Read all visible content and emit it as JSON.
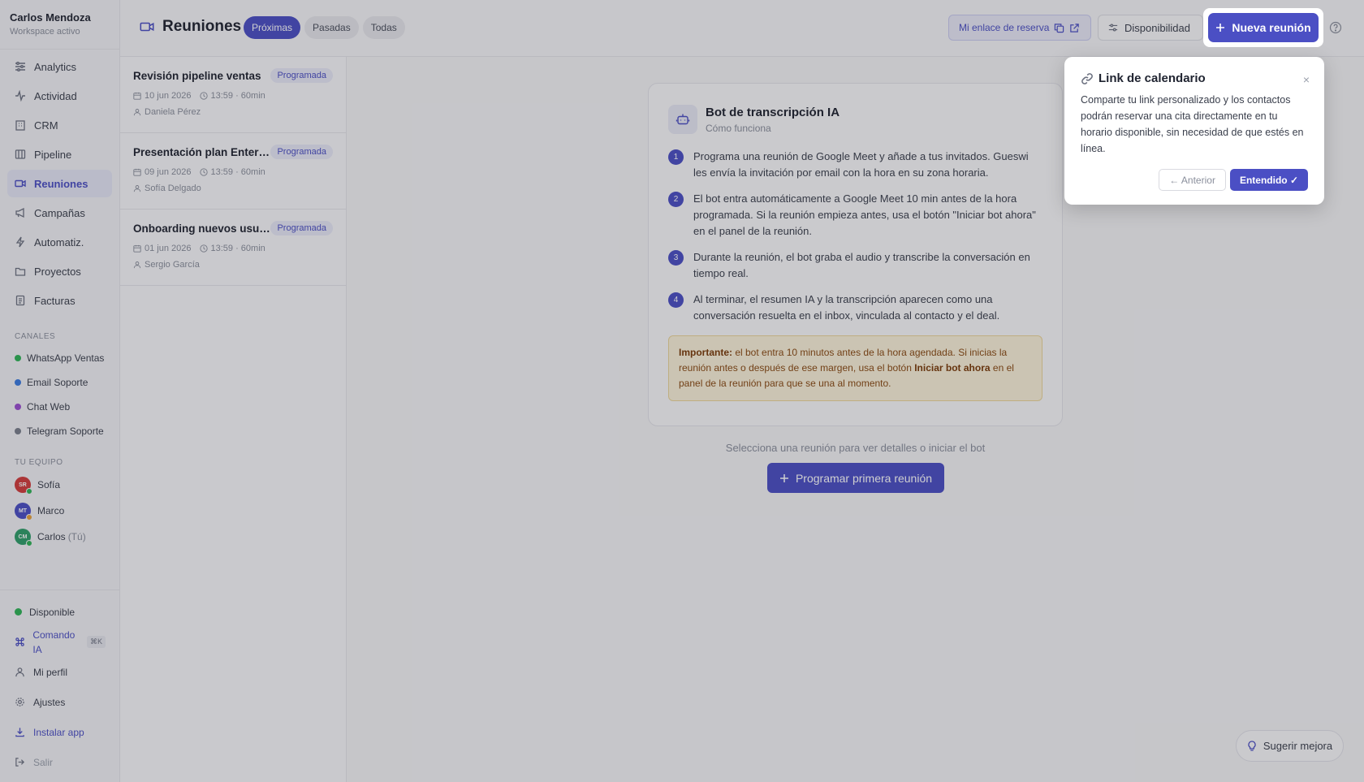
{
  "user": {
    "name": "Carlos Mendoza",
    "subtitle": "Workspace activo"
  },
  "nav": [
    {
      "label": "Analytics",
      "icon": "sliders-icon"
    },
    {
      "label": "Actividad",
      "icon": "activity-icon"
    },
    {
      "label": "CRM",
      "icon": "building-icon"
    },
    {
      "label": "Pipeline",
      "icon": "columns-icon"
    },
    {
      "label": "Reuniones",
      "icon": "video-icon",
      "active": true
    },
    {
      "label": "Campañas",
      "icon": "megaphone-icon"
    },
    {
      "label": "Automatiz.",
      "icon": "bolt-icon"
    },
    {
      "label": "Proyectos",
      "icon": "folder-icon"
    },
    {
      "label": "Facturas",
      "icon": "invoice-icon"
    }
  ],
  "channels": {
    "label": "CANALES",
    "items": [
      {
        "label": "WhatsApp Ventas",
        "color": "#2fb457"
      },
      {
        "label": "Email Soporte",
        "color": "#3a7be0"
      },
      {
        "label": "Chat Web",
        "color": "#9b4fd1"
      },
      {
        "label": "Telegram Soporte",
        "color": "#7a7f8c"
      }
    ]
  },
  "team": {
    "label": "TU EQUIPO",
    "members": [
      {
        "initials": "SR",
        "name": "Sofía",
        "color": "#d23b3b",
        "status": "#2fb457",
        "you": ""
      },
      {
        "initials": "MT",
        "name": "Marco",
        "color": "#4b4fc4",
        "status": "#e8a23a",
        "you": ""
      },
      {
        "initials": "CM",
        "name": "Carlos",
        "color": "#2f9e6a",
        "status": "#2fb457",
        "you": "(Tú)"
      }
    ]
  },
  "bottom": {
    "status": "Disponible",
    "command": "Comando IA",
    "command_kbd": "⌘K",
    "profile": "Mi perfil",
    "settings": "Ajustes",
    "install": "Instalar app",
    "logout": "Salir"
  },
  "header": {
    "title": "Reuniones",
    "tabs": [
      "Próximas",
      "Pasadas",
      "Todas"
    ],
    "booking_link": "Mi enlace de reserva",
    "availability": "Disponibilidad",
    "new_meeting": "Nueva reunión"
  },
  "meetings": [
    {
      "title": "Revisión pipeline ventas",
      "status": "Programada",
      "date": "10 jun 2026",
      "time": "13:59 · 60min",
      "person": "Daniela Pérez"
    },
    {
      "title": "Presentación plan Enterprise",
      "status": "Programada",
      "date": "09 jun 2026",
      "time": "13:59 · 60min",
      "person": "Sofía Delgado"
    },
    {
      "title": "Onboarding nuevos usuarios",
      "status": "Programada",
      "date": "01 jun 2026",
      "time": "13:59 · 60min",
      "person": "Sergio García"
    }
  ],
  "bot_card": {
    "title": "Bot de transcripción IA",
    "subtitle": "Cómo funciona",
    "steps": [
      "Programa una reunión de Google Meet y añade a tus invitados. Gueswi les envía la invitación por email con la hora en su zona horaria.",
      "El bot entra automáticamente a Google Meet 10 min antes de la hora programada. Si la reunión empieza antes, usa el botón \"Iniciar bot ahora\" en el panel de la reunión.",
      "Durante la reunión, el bot graba el audio y transcribe la conversación en tiempo real.",
      "Al terminar, el resumen IA y la transcripción aparecen como una conversación resuelta en el inbox, vinculada al contacto y el deal."
    ],
    "note_strong": "Importante:",
    "note_1": " el bot entra 10 minutos antes de la hora agendada. Si inicias la reunión antes o después de ese margen, usa el botón ",
    "note_strong_2": "Iniciar bot ahora",
    "note_2": " en el panel de la reunión para que se una al momento."
  },
  "empty": {
    "hint": "Selecciona una reunión para ver detalles o iniciar el bot",
    "cta": "Programar primera reunión"
  },
  "suggest": "Sugerir mejora",
  "popover": {
    "title": "Link de calendario",
    "close": "×",
    "body": "Comparte tu link personalizado y los contactos podrán reservar una cita directamente en tu horario disponible, sin necesidad de que estés en línea.",
    "prev": "← Anterior",
    "ok": "Entendido ✓"
  }
}
